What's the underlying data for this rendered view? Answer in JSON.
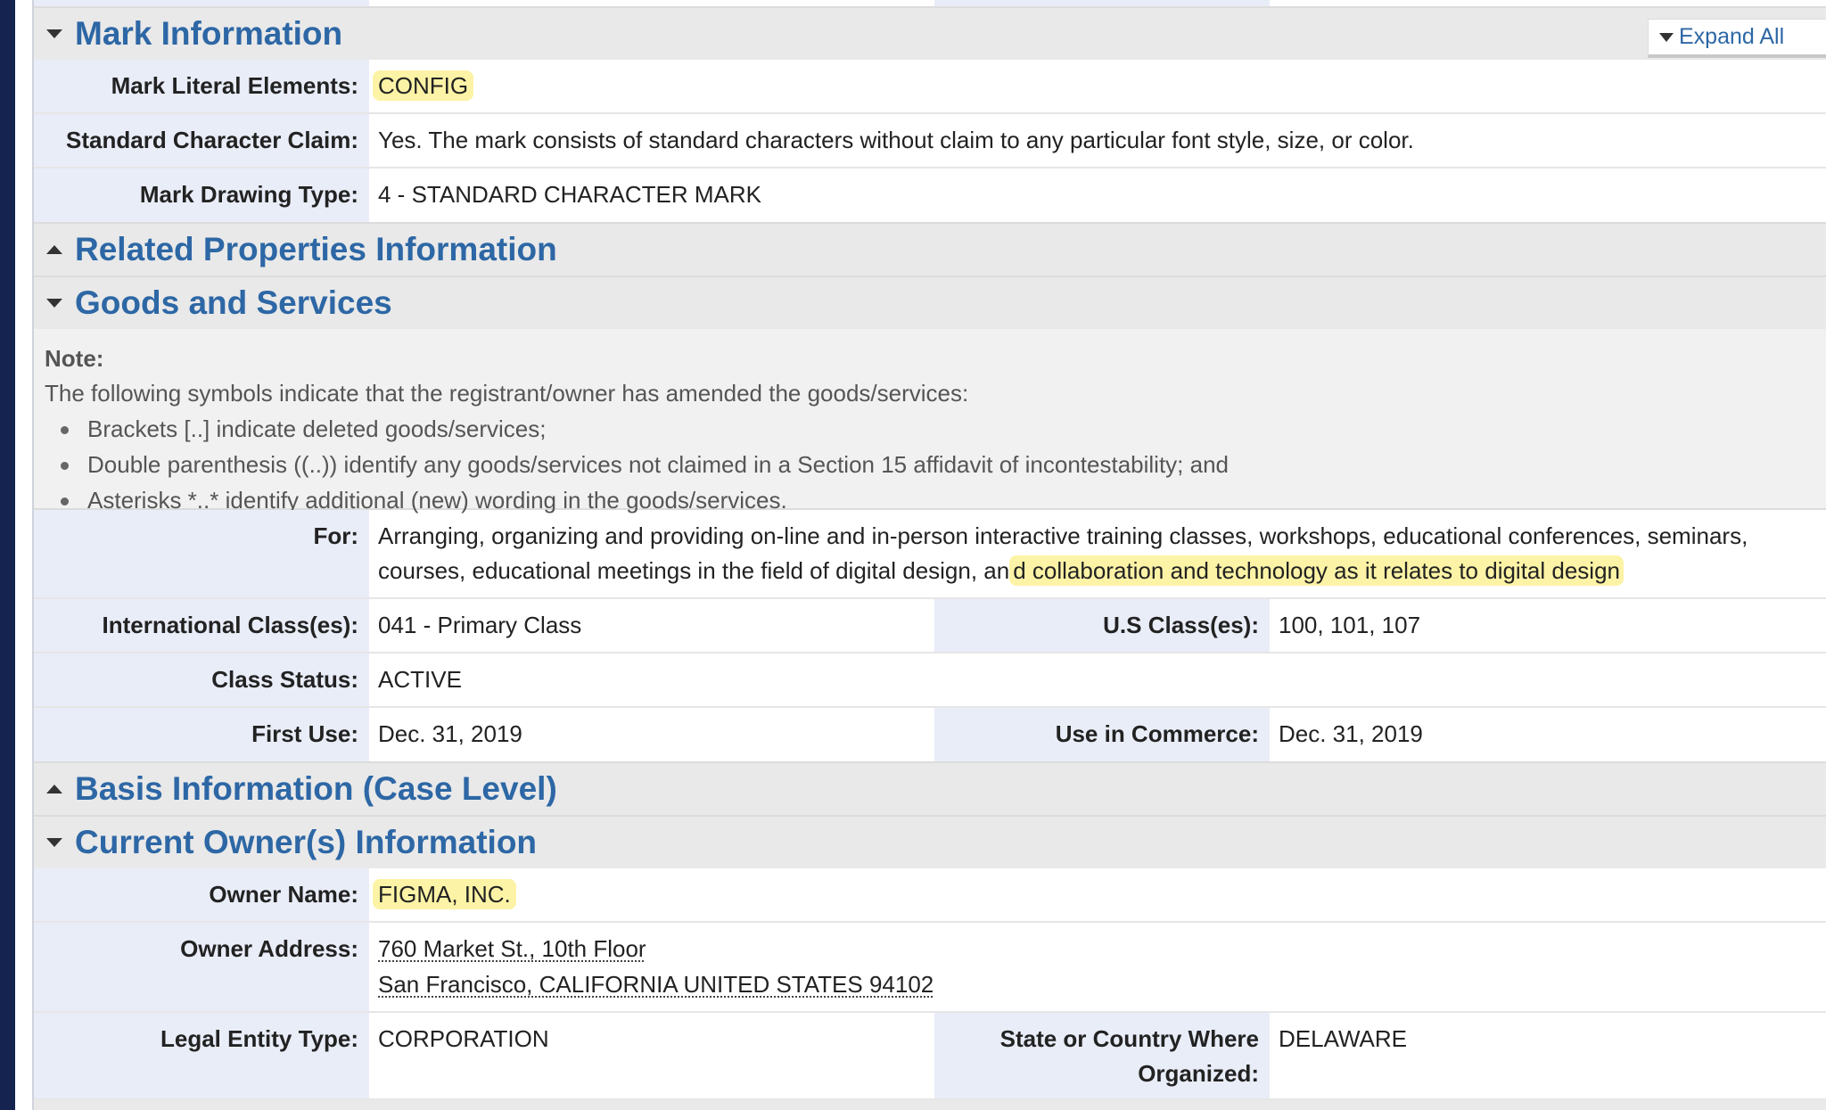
{
  "sections": {
    "mark_information": {
      "title": "Mark Information",
      "expand_all": "Expand All",
      "rows": {
        "literal": {
          "label": "Mark Literal Elements:",
          "value": "CONFIG"
        },
        "standard_char": {
          "label": "Standard Character Claim:",
          "value": "Yes. The mark consists of standard characters without claim to any particular font style, size, or color."
        },
        "drawing_type": {
          "label": "Mark Drawing Type:",
          "value": "4 - STANDARD CHARACTER MARK"
        }
      }
    },
    "related_properties": {
      "title": "Related Properties Information"
    },
    "goods_services": {
      "title": "Goods and Services",
      "note_title": "Note:",
      "note_intro": "The following symbols indicate that the registrant/owner has amended the goods/services:",
      "bullets": [
        "Brackets [..] indicate deleted goods/services;",
        "Double parenthesis ((..)) identify any goods/services not claimed in a Section 15 affidavit of incontestability; and",
        "Asterisks *..* identify additional (new) wording in the goods/services."
      ],
      "for_label": "For:",
      "for_line1": "Arranging, organizing and providing on-line and in-person interactive training classes, workshops, educational conferences, seminars,",
      "for_line2_plain": "courses, educational meetings in the field of digital design, an",
      "for_line2_hl": "d collaboration and technology as it relates to digital design",
      "intl_class_label": "International Class(es):",
      "intl_class_value": "041 - Primary Class",
      "us_class_label": "U.S Class(es):",
      "us_class_value": "100, 101, 107",
      "class_status_label": "Class Status:",
      "class_status_value": "ACTIVE",
      "first_use_label": "First Use:",
      "first_use_value": "Dec. 31, 2019",
      "commerce_label": "Use in Commerce:",
      "commerce_value": "Dec. 31, 2019"
    },
    "basis": {
      "title": "Basis Information (Case Level)"
    },
    "owner": {
      "title": "Current Owner(s) Information",
      "name_label": "Owner Name:",
      "name_value": "FIGMA, INC.",
      "address_label": "Owner Address:",
      "address_line1": "760 Market St., 10th Floor",
      "address_line2": "San Francisco, CALIFORNIA UNITED STATES 94102",
      "entity_label": "Legal Entity Type:",
      "entity_value": "CORPORATION",
      "state_label_line1": "State or Country Where",
      "state_label_line2": "Organized:",
      "state_value": "DELAWARE"
    }
  }
}
